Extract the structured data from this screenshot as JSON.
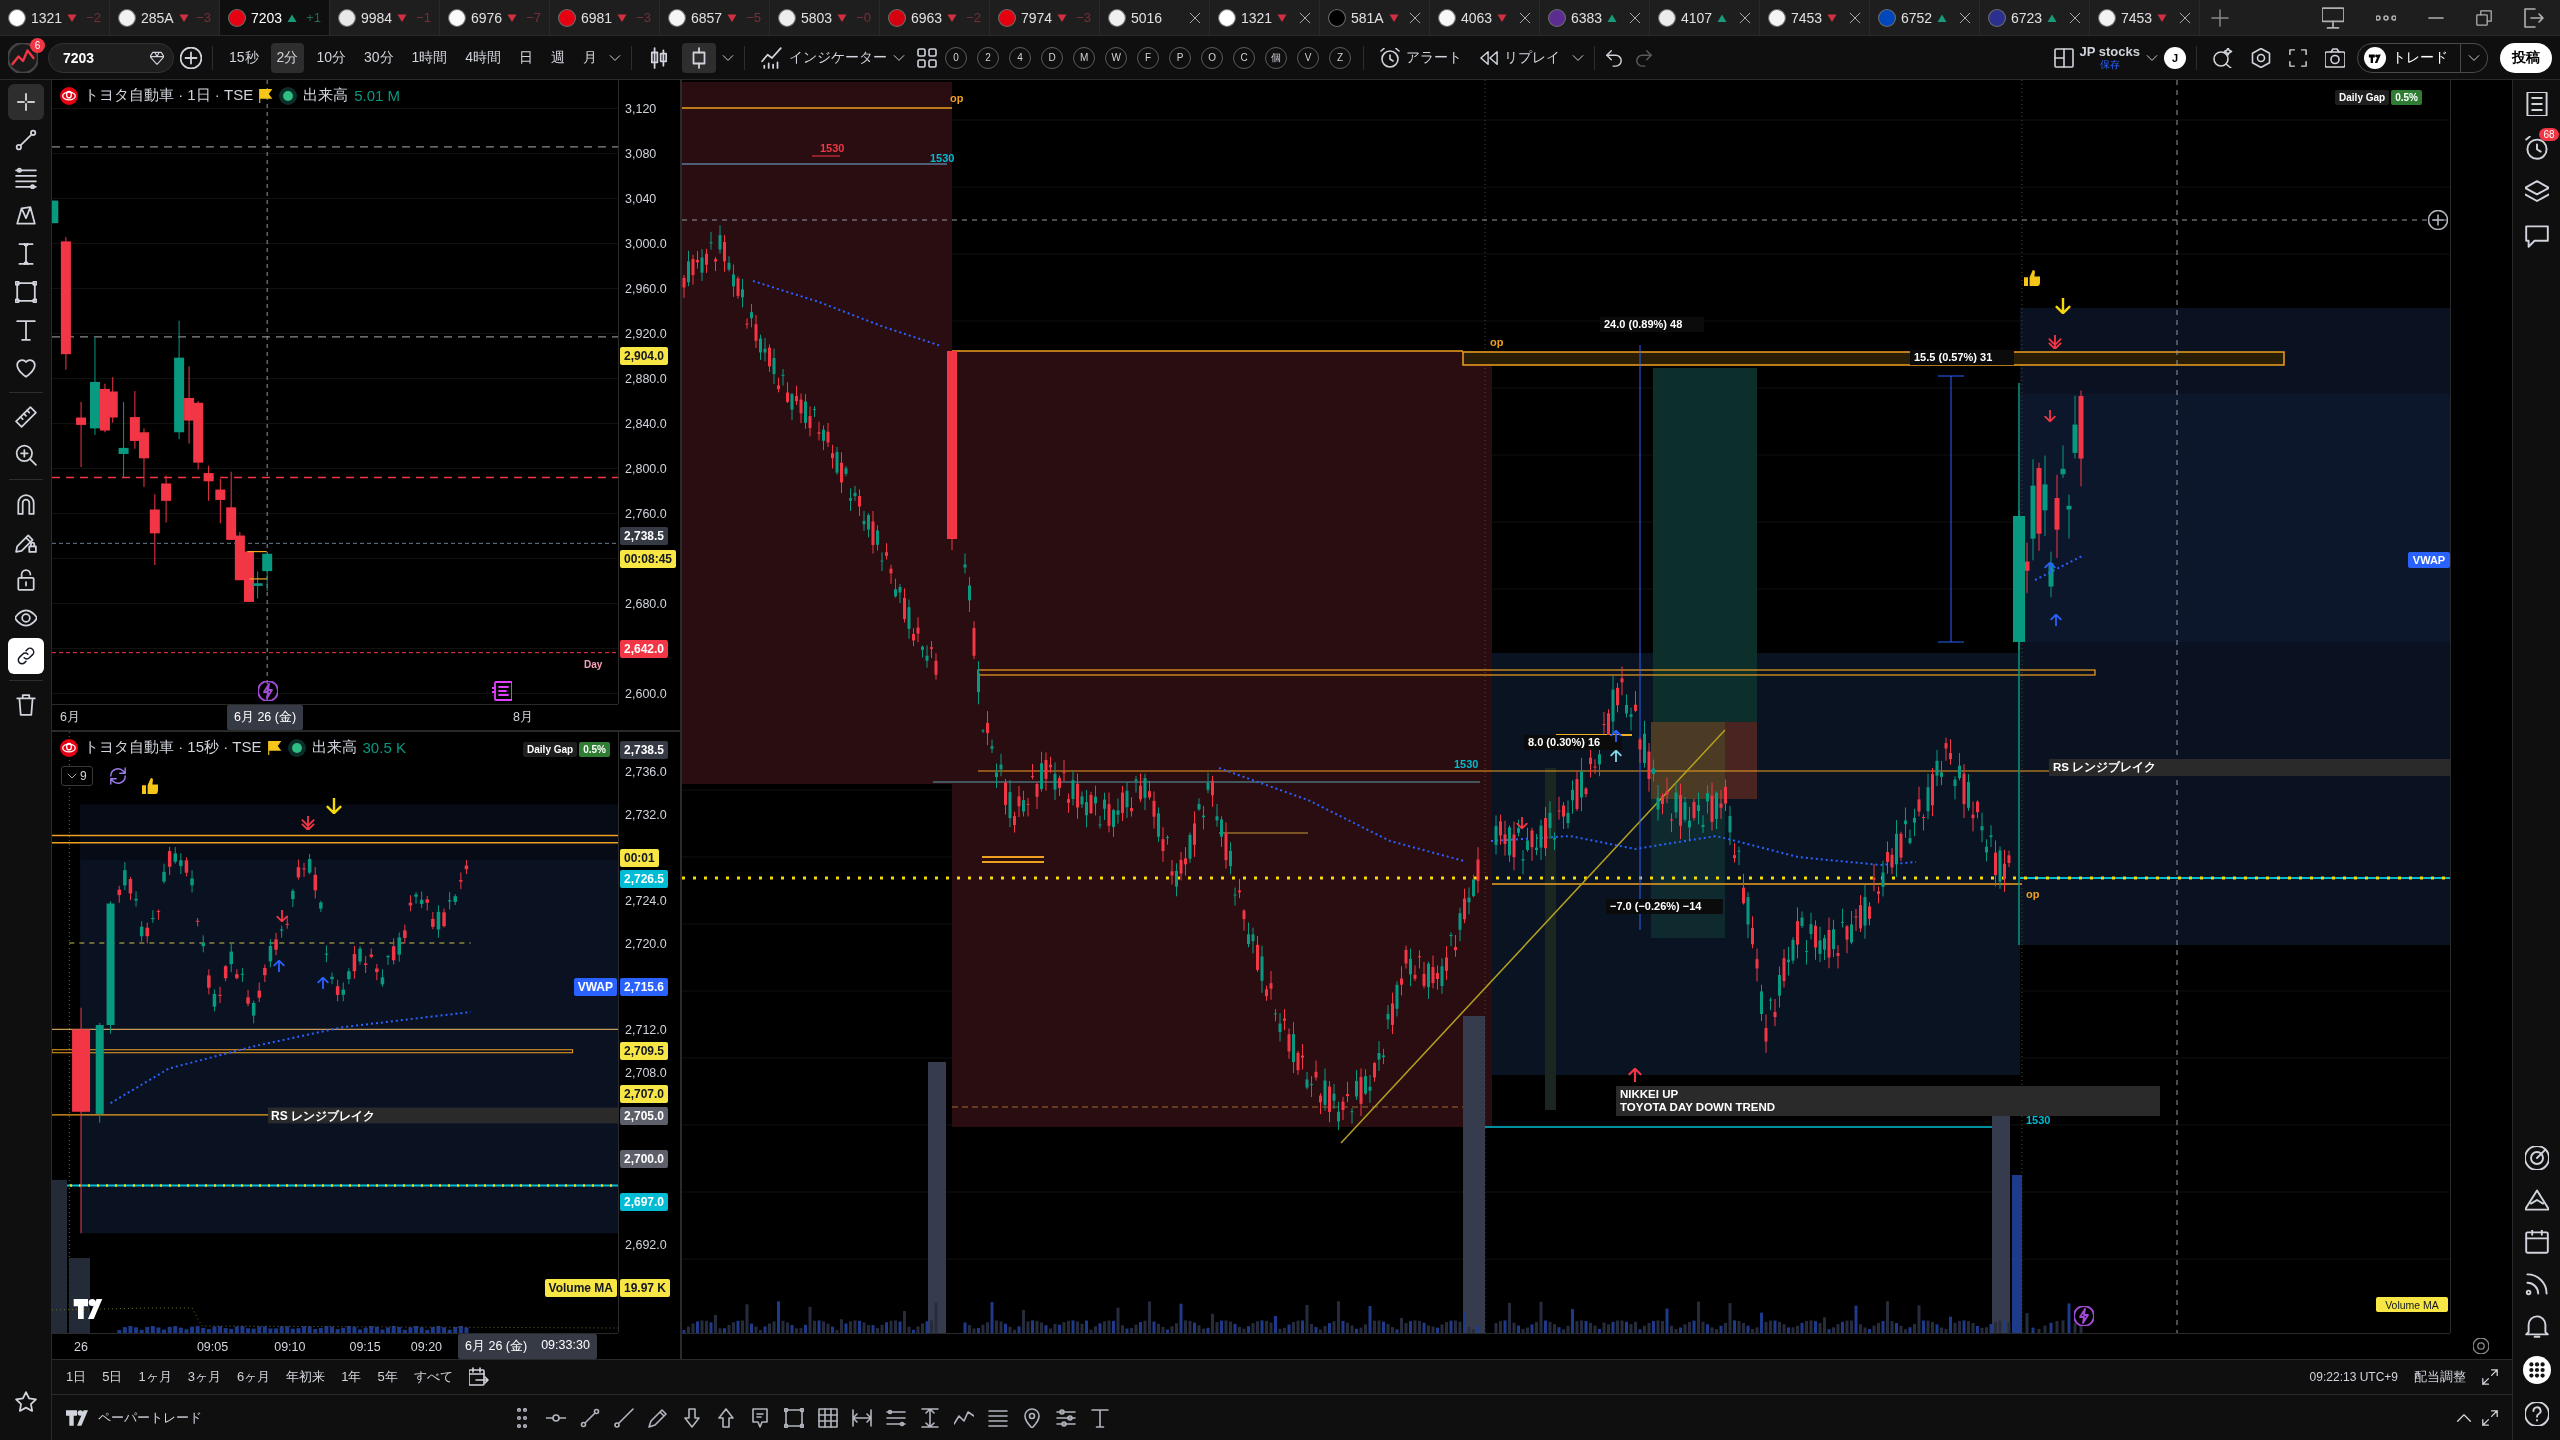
{
  "tabs": [
    {
      "symbol": "1321",
      "kind": "falling",
      "change": "−2",
      "color": "#ffffff",
      "selected": false
    },
    {
      "symbol": "285A",
      "kind": "falling",
      "change": "−3",
      "color": "#f2f2f2",
      "selected": false
    },
    {
      "symbol": "7203",
      "kind": "rising",
      "change": "+1",
      "color": "#e50012",
      "selected": true
    },
    {
      "symbol": "9984",
      "kind": "falling",
      "change": "−1",
      "color": "#e8e8e8",
      "selected": false
    },
    {
      "symbol": "6976",
      "kind": "falling",
      "change": "−7",
      "color": "#fafafa",
      "selected": false
    },
    {
      "symbol": "6981",
      "kind": "falling",
      "change": "−3",
      "color": "#e60012",
      "selected": false
    },
    {
      "symbol": "6857",
      "kind": "falling",
      "change": "−5",
      "color": "#f5f5f5",
      "selected": false
    },
    {
      "symbol": "5803",
      "kind": "falling",
      "change": "−0",
      "color": "#eeeeee",
      "selected": false
    },
    {
      "symbol": "6963",
      "kind": "falling",
      "change": "−2",
      "color": "#d7000f",
      "selected": false
    },
    {
      "symbol": "7974",
      "kind": "falling",
      "change": "−3",
      "color": "#e4000f",
      "selected": false
    },
    {
      "symbol": "5016",
      "kind": "plain",
      "color": "#f0f0f0",
      "selected": false
    },
    {
      "symbol": "1321",
      "kind": "falling",
      "color": "#ffffff",
      "selected": false
    },
    {
      "symbol": "581A",
      "kind": "falling",
      "color": "#000000",
      "selected": false
    },
    {
      "symbol": "4063",
      "kind": "falling",
      "color": "#f7f7f7",
      "selected": false
    },
    {
      "symbol": "6383",
      "kind": "rising",
      "color": "#5b2d91",
      "selected": false
    },
    {
      "symbol": "4107",
      "kind": "rising",
      "color": "#ececec",
      "selected": false
    },
    {
      "symbol": "7453",
      "kind": "falling",
      "color": "#f4f4f4",
      "selected": false
    },
    {
      "symbol": "6752",
      "kind": "rising",
      "color": "#0047bb",
      "selected": false
    },
    {
      "symbol": "6723",
      "kind": "rising",
      "color": "#2b2f8e",
      "selected": false
    },
    {
      "symbol": "7453",
      "kind": "falling",
      "color": "#f3f3f3",
      "selected": false
    }
  ],
  "toolbar": {
    "notification_count": "6",
    "symbol": "7203",
    "intervals": [
      {
        "label": "15秒",
        "selected": false
      },
      {
        "label": "2分",
        "selected": true
      },
      {
        "label": "10分",
        "selected": false
      },
      {
        "label": "30分",
        "selected": false
      },
      {
        "label": "1時間",
        "selected": false
      },
      {
        "label": "4時間",
        "selected": false
      },
      {
        "label": "日",
        "selected": false
      },
      {
        "label": "週",
        "selected": false
      },
      {
        "label": "月",
        "selected": false
      }
    ],
    "chart_styles": [
      {
        "kind": "candles",
        "selected": false
      },
      {
        "kind": "hollow-candles",
        "selected": true
      }
    ],
    "indicators": "インジケーター",
    "quick_keys": [
      "0",
      "2",
      "4",
      "D",
      "M",
      "W",
      "F",
      "P",
      "O",
      "C",
      "個",
      "V",
      "Z"
    ],
    "alert": "アラート",
    "replay": "リプレイ",
    "layout_name": "JP stocks",
    "layout_status": "保存",
    "user_initial": "J",
    "trade": "トレード",
    "publish": "投稿"
  },
  "drawing_tools": [
    {
      "kind": "crosshair",
      "selected": true
    },
    {
      "kind": "trend-line",
      "selected": false
    },
    {
      "kind": "fib",
      "selected": false
    },
    {
      "kind": "pattern",
      "selected": false
    },
    {
      "kind": "projection",
      "selected": false
    },
    {
      "kind": "shapes",
      "selected": false
    },
    {
      "kind": "text",
      "selected": false
    },
    {
      "kind": "favorites",
      "selected": false
    }
  ],
  "toggles": [
    {
      "kind": "magnet",
      "on": false
    },
    {
      "kind": "draw-lock",
      "on": false
    },
    {
      "kind": "lock",
      "on": false
    },
    {
      "kind": "eye",
      "on": false
    },
    {
      "kind": "link",
      "on": true
    }
  ],
  "daily_chart": {
    "title": "トヨタ自動車 · 1日 · TSE",
    "volume_label": "出来高",
    "volume": "5.01 M",
    "session_label": "Day",
    "price_axis": [
      {
        "label": "3,120",
        "kind": "tick"
      },
      {
        "label": "3,080",
        "kind": "tick"
      },
      {
        "label": "3,040",
        "kind": "tick"
      },
      {
        "label": "3,000.0",
        "kind": "tick"
      },
      {
        "label": "2,960.0",
        "kind": "tick"
      },
      {
        "label": "2,920.0",
        "kind": "tick"
      },
      {
        "label": "2,904.0",
        "kind": "marker",
        "color": "#f7e644"
      },
      {
        "label": "2,880.0",
        "kind": "tick"
      },
      {
        "label": "2,840.0",
        "kind": "tick"
      },
      {
        "label": "2,800.0",
        "kind": "tick"
      },
      {
        "label": "2,760.0",
        "kind": "tick"
      },
      {
        "label": "2,738.5",
        "kind": "marker",
        "color": "#363a45"
      },
      {
        "label": "00:08:45",
        "kind": "tag",
        "color": "#f7e644"
      },
      {
        "label": "2,680.0",
        "kind": "tick"
      },
      {
        "label": "2,642.0",
        "kind": "tag",
        "color": "#f23645"
      },
      {
        "label": "2,600.0",
        "kind": "tick"
      }
    ],
    "time_axis": [
      {
        "label": "6月",
        "kind": "tick"
      },
      {
        "label": "6月 26 (金)",
        "kind": "cursor"
      },
      {
        "label": "8月",
        "kind": "tick"
      }
    ]
  },
  "intraday_chart": {
    "title": "トヨタ自動車 · 15秒 · TSE",
    "volume_label": "出来高",
    "volume": "30.5 K",
    "daily_gap_label": "Daily Gap",
    "daily_gap_value": "0.5%",
    "hidden_count": "9",
    "note": "RS レンジブレイク",
    "price_axis": [
      {
        "label": "2,738.5",
        "kind": "marker",
        "color": "#363a45"
      },
      {
        "label": "2,736.0",
        "kind": "tick"
      },
      {
        "label": "2,732.0",
        "kind": "tick"
      },
      {
        "label": "00:01",
        "kind": "tag",
        "color": "#f7e644"
      },
      {
        "label": "2,726.5",
        "kind": "marker",
        "color": "#00bcd4"
      },
      {
        "label": "2,724.0",
        "kind": "tick"
      },
      {
        "label": "2,720.0",
        "kind": "tick"
      },
      {
        "label": "2,715.6",
        "kind": "tag",
        "color": "#2962ff",
        "title": "VWAP"
      },
      {
        "label": "2,712.0",
        "kind": "tick"
      },
      {
        "label": "2,709.5",
        "kind": "marker",
        "color": "#f7e644"
      },
      {
        "label": "2,708.0",
        "kind": "tick"
      },
      {
        "label": "2,707.0",
        "kind": "marker",
        "color": "#f7e644"
      },
      {
        "label": "2,705.0",
        "kind": "tag",
        "color": "#5d606b"
      },
      {
        "label": "2,700.0",
        "kind": "tag",
        "color": "#5d606b"
      },
      {
        "label": "2,697.0",
        "kind": "tag",
        "color": "#00bcd4"
      },
      {
        "label": "2,692.0",
        "kind": "tick"
      },
      {
        "label": "19.97 K",
        "kind": "tag",
        "color": "#f7e644",
        "title": "Volume MA"
      }
    ],
    "time_axis": [
      {
        "label": "26",
        "kind": "tick"
      },
      {
        "label": "09:05",
        "kind": "tick"
      },
      {
        "label": "09:10",
        "kind": "tick"
      },
      {
        "label": "09:15",
        "kind": "tick"
      },
      {
        "label": "09:20",
        "kind": "tick"
      },
      {
        "label": "6月 26 (金)",
        "time": "09:33:30",
        "kind": "cursor"
      }
    ]
  },
  "main_chart": {
    "daily_gap_label": "Daily Gap",
    "daily_gap_value": "0.5%",
    "annotations": [
      {
        "kind": "level",
        "text": "op",
        "color": "#f0a020"
      },
      {
        "kind": "level",
        "text": "1530",
        "color": "#f23645"
      },
      {
        "kind": "level",
        "text": "1530",
        "color": "#00bcd4"
      },
      {
        "kind": "measure",
        "text": "24.0 (0.89%) 48"
      },
      {
        "kind": "level",
        "text": "op",
        "color": "#f0a020"
      },
      {
        "kind": "measure",
        "text": "15.5 (0.57%) 31"
      },
      {
        "kind": "measure",
        "text": "8.0 (0.30%) 16"
      },
      {
        "kind": "level",
        "text": "1530",
        "color": "#00bcd4"
      },
      {
        "kind": "note",
        "text": "RS レンジブレイク"
      },
      {
        "kind": "level",
        "text": "op",
        "color": "#f0a020"
      },
      {
        "kind": "measure",
        "text": "−7.0 (−0.26%) −14"
      },
      {
        "kind": "note",
        "text": "NIKKEI UP\nTOYOTA DAY DOWN TREND"
      },
      {
        "kind": "level",
        "text": "1530",
        "color": "#00bcd4"
      }
    ],
    "vwap_tag": "VWAP",
    "volume_ma_tag": "Volume MA"
  },
  "range_bar": {
    "ranges": [
      "1日",
      "5日",
      "1ヶ月",
      "3ヶ月",
      "6ヶ月",
      "年初来",
      "1年",
      "5年",
      "すべて"
    ],
    "clock": "09:22:13 UTC+9",
    "adjustment": "配当調整"
  },
  "bottom_bar": {
    "label": "ペーパートレード"
  },
  "right_sidebar": {
    "alert_count": "68"
  }
}
